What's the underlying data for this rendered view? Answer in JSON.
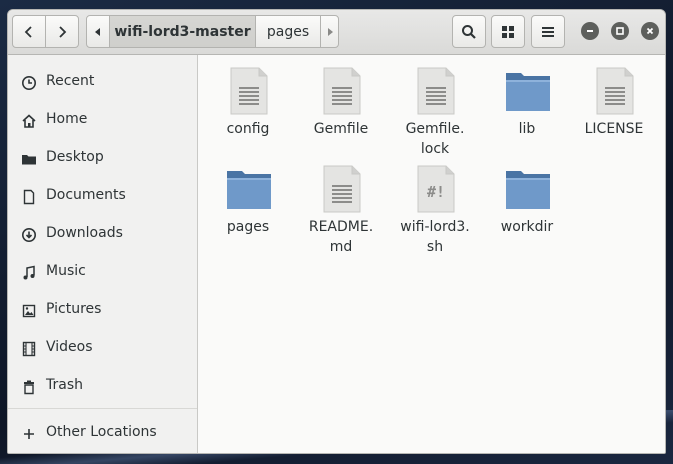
{
  "path": {
    "current": "wifi-lord3-master",
    "next": "pages"
  },
  "sidebar": {
    "items": [
      {
        "label": "Recent",
        "icon": "clock-icon"
      },
      {
        "label": "Home",
        "icon": "home-icon"
      },
      {
        "label": "Desktop",
        "icon": "folder-icon"
      },
      {
        "label": "Documents",
        "icon": "document-icon"
      },
      {
        "label": "Downloads",
        "icon": "download-icon"
      },
      {
        "label": "Music",
        "icon": "music-note-icon"
      },
      {
        "label": "Pictures",
        "icon": "picture-icon"
      },
      {
        "label": "Videos",
        "icon": "film-icon"
      },
      {
        "label": "Trash",
        "icon": "trash-icon"
      }
    ],
    "other_locations": "Other Locations"
  },
  "files": [
    {
      "name": "config",
      "type": "text"
    },
    {
      "name": "Gemfile",
      "type": "text"
    },
    {
      "name": "Gemfile.\nlock",
      "type": "text"
    },
    {
      "name": "lib",
      "type": "folder"
    },
    {
      "name": "LICENSE",
      "type": "text"
    },
    {
      "name": "pages",
      "type": "folder"
    },
    {
      "name": "README.\nmd",
      "type": "text"
    },
    {
      "name": "wifi-lord3.\nsh",
      "type": "script"
    },
    {
      "name": "workdir",
      "type": "folder"
    }
  ],
  "colors": {
    "folder": "#6f99c9",
    "folder_tab": "#4a74a4",
    "document": "#e4e4e2"
  }
}
